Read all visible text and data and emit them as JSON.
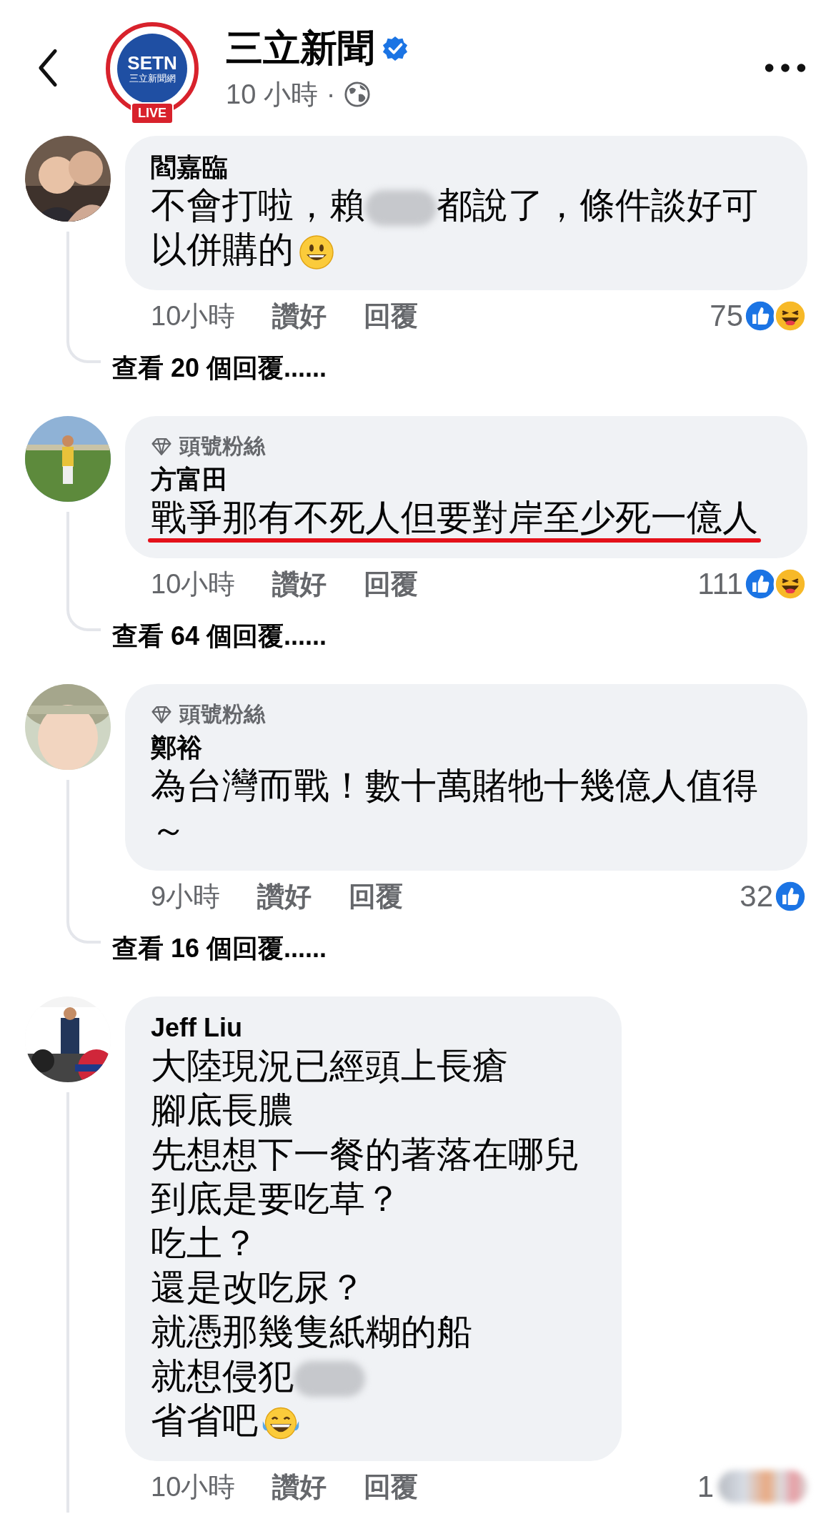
{
  "header": {
    "logo": {
      "brand": "SETN",
      "subtitle": "三立新聞網",
      "live": "LIVE"
    },
    "title": "三立新聞",
    "verified": true,
    "time": "10 小時",
    "separator": "·"
  },
  "comments": [
    {
      "name": "閻嘉臨",
      "narrow": false,
      "segments": [
        {
          "kind": "text",
          "text": "不會打啦，賴"
        },
        {
          "kind": "redacted"
        },
        {
          "kind": "text",
          "text": "都說了，條件談好可"
        },
        {
          "kind": "break"
        },
        {
          "kind": "text",
          "text": "以併購的"
        },
        {
          "kind": "emoji_smile"
        }
      ],
      "underlined": false,
      "time": "10小時",
      "like": "讚好",
      "reply": "回覆",
      "count": "75",
      "reactions": [
        {
          "kind": "like"
        },
        {
          "kind": "haha"
        }
      ],
      "view_replies": "查看 20 個回覆......"
    },
    {
      "badge": "頭號粉絲",
      "name": "方富田",
      "narrow": false,
      "segments": [
        {
          "kind": "text",
          "text": "戰爭那有不死人但要對岸至少死一億人"
        }
      ],
      "underlined": true,
      "time": "10小時",
      "like": "讚好",
      "reply": "回覆",
      "count": "111",
      "reactions": [
        {
          "kind": "like"
        },
        {
          "kind": "haha"
        }
      ],
      "view_replies": "查看 64 個回覆......"
    },
    {
      "badge": "頭號粉絲",
      "name": "鄭裕",
      "narrow": false,
      "segments": [
        {
          "kind": "text",
          "text": "為台灣而戰！數十萬賭牠十幾億人值得"
        },
        {
          "kind": "break"
        },
        {
          "kind": "text",
          "text": "～"
        }
      ],
      "underlined": false,
      "time": "9小時",
      "like": "讚好",
      "reply": "回覆",
      "count": "32",
      "reactions": [
        {
          "kind": "like"
        }
      ],
      "view_replies": "查看 16 個回覆......"
    },
    {
      "name": "Jeff Liu",
      "narrow": true,
      "segments": [
        {
          "kind": "text",
          "text": "大陸現況已經頭上長瘡"
        },
        {
          "kind": "break"
        },
        {
          "kind": "text",
          "text": "腳底長膿"
        },
        {
          "kind": "break"
        },
        {
          "kind": "text",
          "text": "先想想下一餐的著落在哪兒"
        },
        {
          "kind": "break"
        },
        {
          "kind": "text",
          "text": "到底是要吃草？"
        },
        {
          "kind": "break"
        },
        {
          "kind": "text",
          "text": "吃土？"
        },
        {
          "kind": "break"
        },
        {
          "kind": "text",
          "text": "還是改吃尿？"
        },
        {
          "kind": "break"
        },
        {
          "kind": "text",
          "text": "就憑那幾隻紙糊的船"
        },
        {
          "kind": "break"
        },
        {
          "kind": "text",
          "text": "就想侵犯"
        },
        {
          "kind": "redacted"
        },
        {
          "kind": "break"
        },
        {
          "kind": "text",
          "text": "省省吧"
        },
        {
          "kind": "emoji_joy"
        }
      ],
      "underlined": false,
      "time": "10小時",
      "like": "讚好",
      "reply": "回覆",
      "count": "1",
      "reactions": [
        {
          "kind": "redacted"
        }
      ]
    }
  ]
}
